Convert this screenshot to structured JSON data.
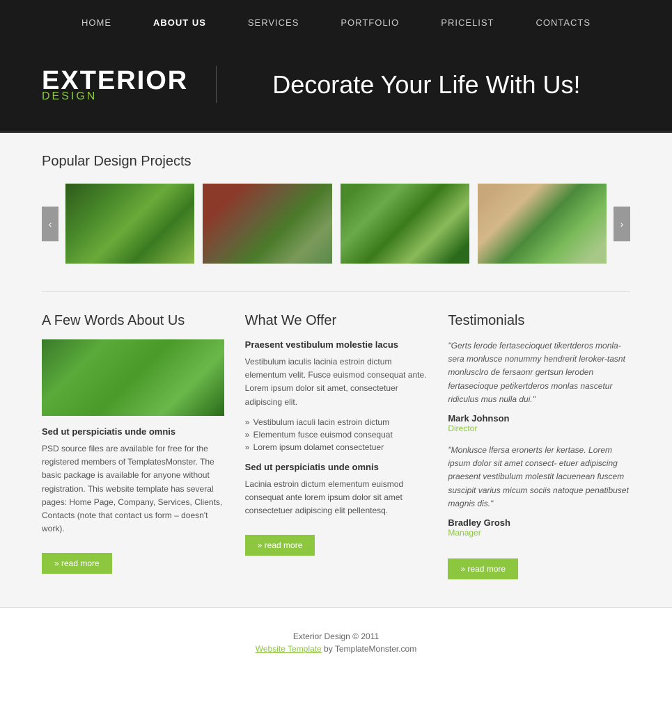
{
  "nav": {
    "items": [
      {
        "label": "HOME",
        "active": false
      },
      {
        "label": "ABOUT US",
        "active": true
      },
      {
        "label": "SERVICES",
        "active": false
      },
      {
        "label": "PORTFOLIO",
        "active": false
      },
      {
        "label": "PRICELIST",
        "active": false
      },
      {
        "label": "CONTACTS",
        "active": false
      }
    ]
  },
  "hero": {
    "brand_main": "EXTERIOR",
    "brand_sub": "DESIGN",
    "tagline": "Decorate Your Life With Us!"
  },
  "projects": {
    "title": "Popular Design Projects",
    "prev_label": "‹",
    "next_label": "›"
  },
  "about": {
    "title": "A Few Words About Us",
    "subtitle": "Sed ut perspiciatis unde omnis",
    "body": "PSD source files are available for free for the registered members of TemplatesMonster. The basic package is available for anyone without registration. This website template has several pages: Home Page, Company, Services, Clients, Contacts (note that contact us form – doesn't work).",
    "read_more": "» read more"
  },
  "offer": {
    "title": "What We Offer",
    "lead_title": "Praesent vestibulum molestie lacus",
    "lead_text": "Vestibulum iaculis lacinia estroin dictum elementum velit. Fusce euismod consequat ante. Lorem ipsum dolor sit amet, consectetuer adipiscing elit.",
    "list_items": [
      "Vestibulum iaculi lacin estroin dictum",
      "Elementum fusce euismod consequat",
      "Lorem ipsum dolamet consectetuer"
    ],
    "sub_title": "Sed ut perspiciatis unde omnis",
    "sub_text": "Lacinia estroin dictum elementum euismod consequat ante lorem ipsum dolor sit amet consectetuer adipiscing elit pellentesq.",
    "read_more": "» read more"
  },
  "testimonials": {
    "title": "Testimonials",
    "items": [
      {
        "quote": "\"Gerts lerode fertasecioquet tikertderos monla-sera monlusce nonummy hendrerit leroker-tasnt monlusclro de fersaonr gertsun leroden fertasecioque petikertderos monlas nascetur ridiculus mus nulla dui.\"",
        "name": "Mark Johnson",
        "role": "Director"
      },
      {
        "quote": "\"Monlusce lfersa eronerts ler kertase. Lorem ipsum dolor sit amet consect- etuer adipiscing praesent vestibulum molestit lacuenean fuscem suscipit varius micum sociis natoque penatibuset magnis dis.\"",
        "name": "Bradley Grosh",
        "role": "Manager"
      }
    ],
    "read_more": "» read more"
  },
  "footer": {
    "copyright": "Exterior Design © 2011",
    "link_text": "Website Template",
    "suffix": " by TemplateMonster.com"
  }
}
